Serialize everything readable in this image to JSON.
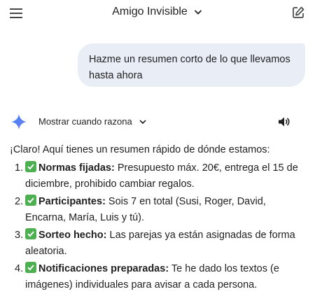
{
  "header": {
    "title": "Amigo Invisible"
  },
  "user_message": "Hazme un resumen corto de lo que llevamos hasta ahora",
  "model": {
    "thinking_toggle_label": "Mostrar cuando razona"
  },
  "response": {
    "intro": "¡Claro! Aquí tienes un resumen rápido de dónde estamos:",
    "items": [
      {
        "number": "1.",
        "bold": "Normas fijadas:",
        "text": " Presupuesto máx. 20€, entrega el 15 de diciembre, prohibido cambiar regalos."
      },
      {
        "number": "2.",
        "bold": "Participantes:",
        "text": " Sois 7 en total (Susi, Roger, David, Encarna, María, Luis y tú)."
      },
      {
        "number": "3.",
        "bold": "Sorteo hecho:",
        "text": " Las parejas ya están asignadas de forma aleatoria."
      },
      {
        "number": "4.",
        "bold": "Notificaciones preparadas:",
        "text": " Te he dado los textos (e imágenes) individuales para avisar a cada persona."
      }
    ]
  },
  "colors": {
    "user_bubble": "#e9eef6",
    "check_emoji": "#4caf50",
    "gemini_spark": "#4285f4"
  }
}
